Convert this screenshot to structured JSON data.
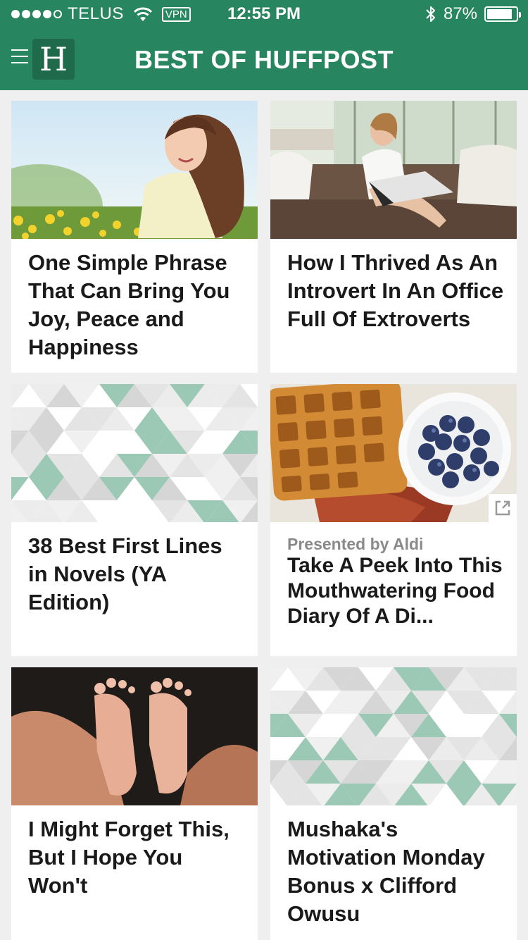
{
  "status_bar": {
    "carrier": "TELUS",
    "vpn": "VPN",
    "time": "12:55 PM",
    "battery": "87%",
    "battery_level": 0.87
  },
  "nav": {
    "logo_letter": "H",
    "title": "BEST OF HUFFPOST"
  },
  "cards": [
    {
      "title": "One Simple Phrase That Can Bring You Joy, Peace and Happiness"
    },
    {
      "title": "How I Thrived As An Introvert In An Office Full Of Extroverts"
    },
    {
      "title": "38 Best First Lines in Novels (YA Edition)"
    },
    {
      "sponsor": "Presented by Aldi",
      "title": "Take A Peek Into This Mouthwatering Food Diary Of A Di..."
    },
    {
      "title": "I Might Forget This, But I Hope You Won't"
    },
    {
      "title": "Mushaka's Motivation Monday Bonus x Clifford Owusu"
    }
  ],
  "colors": {
    "header": "#27855f",
    "pattern_accent": "#9cc8b6"
  }
}
